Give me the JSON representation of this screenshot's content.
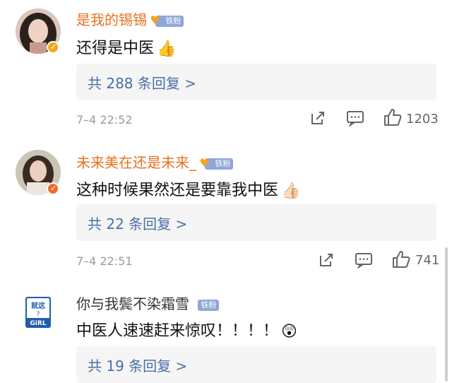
{
  "comments": [
    {
      "username": "是我的锡锡",
      "badge": "铁粉",
      "text": "还得是中医",
      "emoji": "👍",
      "replies": "共 288 条回复 >",
      "time": "7–4 22:52",
      "likes": "1203"
    },
    {
      "username": "未来美在还是未来_",
      "badge": "铁粉",
      "text": "这种时候果然还是要靠我中医",
      "emoji": "👍🏻",
      "replies": "共 22 条回复 >",
      "time": "7–4 22:51",
      "likes": "741"
    },
    {
      "username": "你与我鬓不染霜雪",
      "badge": "铁粉",
      "text": "中医人速速赶来惊叹！！！！",
      "emoji": "😲",
      "replies": "共 19 条回复 >",
      "avatar_text_top": "就这",
      "avatar_text_mid": "?",
      "avatar_text_bottom": "GiRL"
    }
  ],
  "colors": {
    "username_orange": "#e8721e",
    "reply_blue": "#4a6fa8",
    "badge_bg": "#8ea7d8"
  }
}
